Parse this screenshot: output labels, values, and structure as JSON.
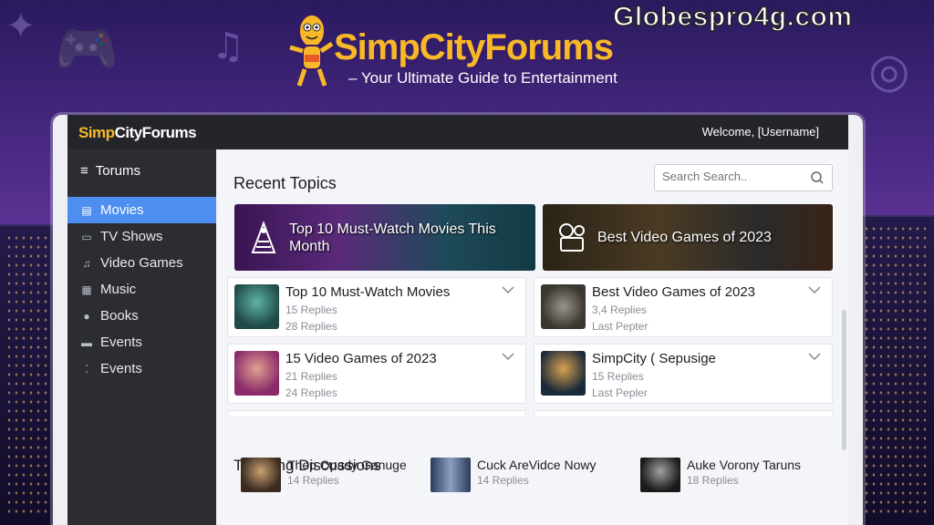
{
  "watermark": "Globespro4g.com",
  "hero": {
    "title": "SimpCityForums",
    "tagline": "– Your Ultimate Guide to Entertainment"
  },
  "topbar": {
    "brand_highlight": "Simp",
    "brand_rest": "CityForums",
    "welcome": "Welcome, [Username]"
  },
  "sidebar": {
    "header": "Torums",
    "items": [
      {
        "label": "Movies",
        "icon": "film-icon",
        "active": true
      },
      {
        "label": "TV Shows",
        "icon": "tv-icon",
        "active": false
      },
      {
        "label": "Video Games",
        "icon": "music-note-icon",
        "active": false
      },
      {
        "label": "Music",
        "icon": "music-icon",
        "active": false
      },
      {
        "label": "Books",
        "icon": "book-icon",
        "active": false
      },
      {
        "label": "Events",
        "icon": "calendar-icon",
        "active": false
      },
      {
        "label": "Events",
        "icon": "events-icon",
        "active": false
      }
    ]
  },
  "search": {
    "placeholder": "Search Search.."
  },
  "recent": {
    "title": "Recent Topics",
    "banners": [
      {
        "title": "Top 10 Must-Watch Movies This Month"
      },
      {
        "title": "Best Video Games of 2023"
      }
    ],
    "cards": [
      {
        "title": "Top 10 Must-Watch Movies",
        "line1": "15 Replies",
        "line2": "28 Replies"
      },
      {
        "title": "Best Video Games of 2023",
        "line1": "3,4 Replies",
        "line2": "Last Pepter"
      },
      {
        "title": "15 Video Games of 2023",
        "line1": "21 Replies",
        "line2": "24 Replies"
      },
      {
        "title": "SimpCity ( Sepusige",
        "line1": "15 Replies",
        "line2": "Last Pepler"
      }
    ]
  },
  "trending": {
    "title": "Trending Discussions",
    "items": [
      {
        "title": "Thep Opady Ganuge",
        "sub": "14 Replies"
      },
      {
        "title": "Cuck AreVidce Nowy",
        "sub": "14 Replies"
      },
      {
        "title": "Auke Vorony Taruns",
        "sub": "18 Replies"
      }
    ]
  },
  "colors": {
    "accent": "#4d8ef0",
    "brand_gold": "#f7b928",
    "sidebar_bg": "#2b2d33",
    "topbar_bg": "#23252b"
  }
}
